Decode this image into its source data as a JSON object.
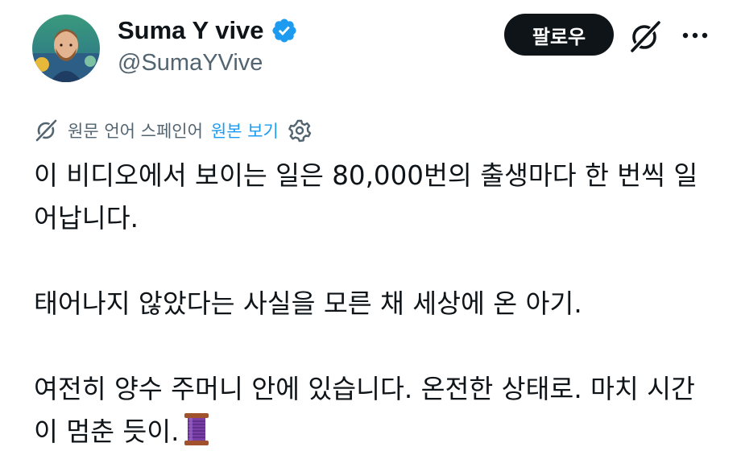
{
  "author": {
    "display_name": "Suma Y vive",
    "handle": "@SumaYVive",
    "verified": true,
    "avatar": "bearded-man-avatar"
  },
  "actions": {
    "follow_label": "팔로우",
    "grok_icon": "grok-icon",
    "more_icon": "more-icon"
  },
  "translation": {
    "icon": "grok-icon",
    "text": "원문 언어 스페인어",
    "show_original_label": "원본 보기",
    "settings_icon": "gear-icon"
  },
  "post": {
    "paragraph_1": "이 비디오에서 보이는 일은 80,000번의 출생마다 한 번씩 일어납니다.",
    "paragraph_2": "태어나지 않았다는 사실을 모른 채 세상에 온 아기.",
    "paragraph_3": "여전히 양수 주머니 안에 있습니다. 온전한 상태로. 마치 시간이 멈춘 듯이.",
    "trailing_emoji": "thread-spool-emoji"
  },
  "colors": {
    "text": "#0f1419",
    "secondary": "#536471",
    "link": "#1d9bf0",
    "verified": "#1d9bf0",
    "button_bg": "#0f1419"
  }
}
